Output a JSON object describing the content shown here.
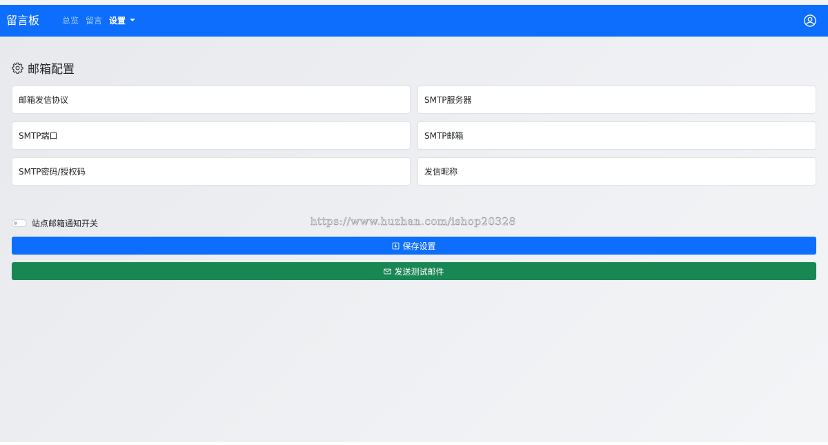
{
  "navbar": {
    "brand": "留言板",
    "links": [
      {
        "label": "总览",
        "active": false
      },
      {
        "label": "留言",
        "active": false
      },
      {
        "label": "设置",
        "active": true
      }
    ],
    "user_icon": "user-circle-icon"
  },
  "section": {
    "icon": "gear-icon",
    "title": "邮箱配置"
  },
  "fields": {
    "protocol": {
      "placeholder": "邮箱发信协议",
      "value": ""
    },
    "smtp_server": {
      "placeholder": "SMTP服务器",
      "value": ""
    },
    "smtp_port": {
      "placeholder": "SMTP端口",
      "value": ""
    },
    "smtp_email": {
      "placeholder": "SMTP邮箱",
      "value": ""
    },
    "smtp_password": {
      "placeholder": "SMTP密码/授权码",
      "value": ""
    },
    "sender_name": {
      "placeholder": "发信昵称",
      "value": ""
    }
  },
  "notify_switch": {
    "label": "站点邮箱通知开关",
    "checked": false
  },
  "watermark": "https://www.huzhan.com/ishop20328",
  "buttons": {
    "save": {
      "label": "保存设置",
      "icon": "save-icon"
    },
    "test": {
      "label": "发送测试邮件",
      "icon": "envelope-icon"
    }
  },
  "colors": {
    "primary": "#0d6efd",
    "success": "#198754"
  }
}
